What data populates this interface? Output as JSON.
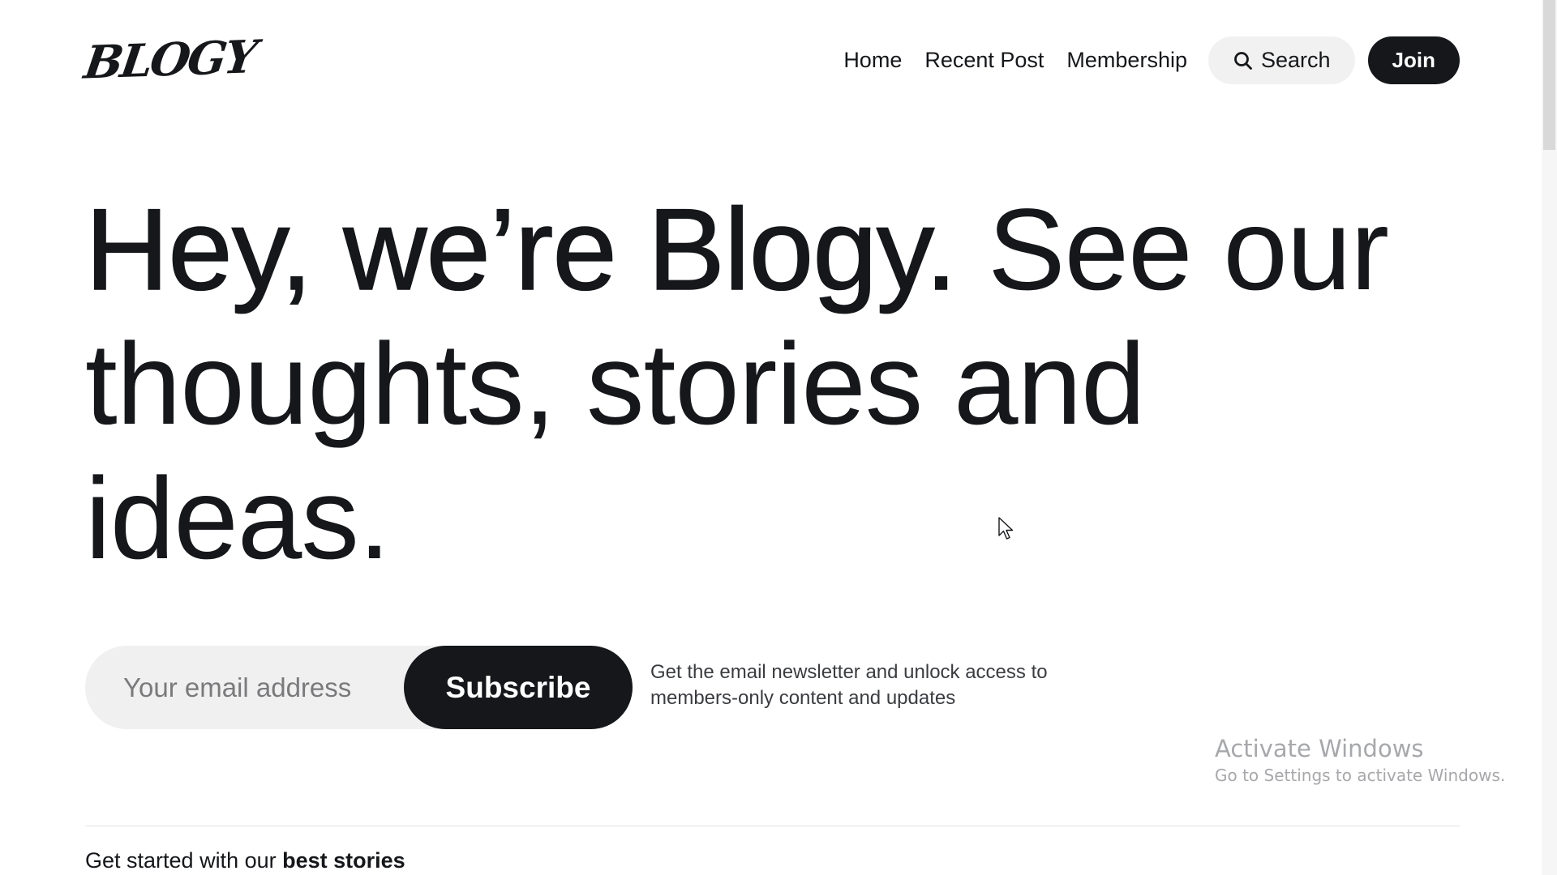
{
  "header": {
    "logo": "BLOGY",
    "nav": [
      "Home",
      "Recent Post",
      "Membership"
    ],
    "search_label": "Search",
    "search_icon": "search-icon",
    "join_label": "Join"
  },
  "hero": {
    "line_strong": "Hey, we’re Blogy.",
    "line_rest": "See our thoughts, stories and ideas."
  },
  "subscribe": {
    "email_placeholder": "Your email address",
    "email_value": "",
    "button_label": "Subscribe",
    "note": "Get the email newsletter and unlock access to members-only content and updates"
  },
  "section": {
    "intro": "Get started with our",
    "emphasis": "best stories"
  },
  "watermark": {
    "title": "Activate Windows",
    "subtitle": "Go to Settings to activate Windows."
  },
  "colors": {
    "text": "#15171a",
    "button_dark": "#15171a",
    "pill_light": "#f1f1f1",
    "muted": "#3a3c40",
    "watermark": "#a7a8ab"
  }
}
